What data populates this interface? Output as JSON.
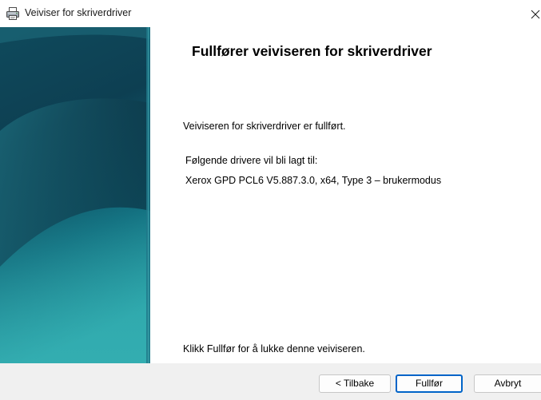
{
  "window": {
    "title": "Veiviser for skriverdriver",
    "title_icon": "printer-icon",
    "close_icon": "close-icon"
  },
  "main": {
    "heading": "Fullfører veiviseren for skriverdriver",
    "completed_text": "Veiviseren for skriverdriver er fullført.",
    "drivers_label": "Følgende drivere vil bli lagt til:",
    "driver_entry": "Xerox GPD PCL6 V5.887.3.0, x64, Type 3 – brukermodus",
    "instruction": "Klikk Fullfør for å lukke denne veiviseren."
  },
  "buttons": {
    "back_label": "< Tilbake",
    "finish_label": "Fullfør",
    "cancel_label": "Avbryt"
  },
  "colors": {
    "banner_dark": "#0d3d4e",
    "banner_mid": "#15707b",
    "banner_light": "#2aa3a8",
    "default_button_border": "#0064c8",
    "footer_background": "#f0f0f0"
  }
}
